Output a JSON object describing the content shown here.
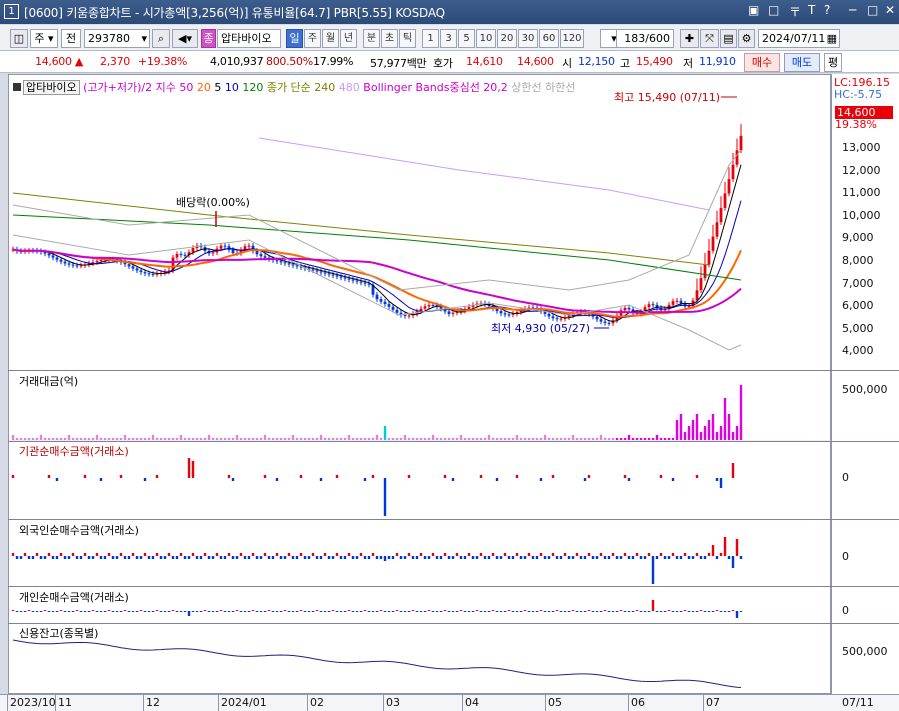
{
  "window": {
    "number": "1",
    "title": "[0600] 키움종합차트 - 시가총액[3,256(억)] 유통비율[64.7] PBR[5.55] KOSDAQ"
  },
  "toolbar": {
    "market": "주",
    "kind": "전",
    "code": "293780",
    "stock_badge": "종",
    "stock_name": "압타바이오",
    "periods": [
      "일",
      "주",
      "월",
      "년",
      "분",
      "초",
      "틱"
    ],
    "selected_period": "일",
    "intervals": [
      "1",
      "3",
      "5",
      "10",
      "20",
      "30",
      "60",
      "120"
    ],
    "count": "183",
    "count_total": "/600",
    "date": "2024/07/11"
  },
  "quote": {
    "price": "14,600",
    "arrow": "▲",
    "change": "2,370",
    "change_pct": "+19.38%",
    "volume": "4,010,937",
    "vol_ratio": "800.50%",
    "turnover": "17.99%",
    "amount": "57,977백만",
    "ask_label": "호가",
    "ask": "14,610",
    "bid": "14,600",
    "open_label": "시",
    "open": "12,150",
    "high_label": "고",
    "high": "15,490",
    "low_label": "저",
    "low": "11,910",
    "buy": "매수",
    "sell": "매도",
    "eval": "평"
  },
  "price_panel": {
    "name": "압타바이오",
    "legend": [
      {
        "text": "(고가+저가)/2 지수 50",
        "color": "#cc00cc"
      },
      {
        "text": "20",
        "color": "#ff6600"
      },
      {
        "text": "5",
        "color": "#000000"
      },
      {
        "text": "10",
        "color": "#0000cc"
      },
      {
        "text": "120",
        "color": "#008000"
      },
      {
        "text": "종가 단순 240",
        "color": "#808000"
      },
      {
        "text": "480",
        "color": "#cc99ff"
      },
      {
        "text": "Bollinger Bands중심선 20,2",
        "color": "#cc00cc"
      },
      {
        "text": "상한선",
        "color": "#aaaaaa"
      },
      {
        "text": "하한선",
        "color": "#aaaaaa"
      }
    ],
    "annotations": {
      "high": "최고 15,490 (07/11)",
      "low": "최저 4,930 (05/27)",
      "dividend": "배당락(0.00%)"
    },
    "axis": [
      "13,000",
      "12,000",
      "11,000",
      "10,000",
      "9,000",
      "8,000",
      "7,000",
      "6,000",
      "5,000",
      "4,000"
    ],
    "lc": "LC:196.15",
    "hc": "HC:-5.75",
    "current": "14,600",
    "current_pct": "19.38%"
  },
  "panels": {
    "amount": {
      "name": "거래대금(억)",
      "axis": "500,000"
    },
    "inst": {
      "name": "기관순매수금액(거래소)",
      "axis": "0"
    },
    "foreign": {
      "name": "외국인순매수금액(거래소)",
      "axis": "0"
    },
    "retail": {
      "name": "개인순매수금액(거래소)",
      "axis": "0"
    },
    "credit": {
      "name": "신용잔고(종목별)",
      "axis": "500,000"
    }
  },
  "xaxis": {
    "labels": [
      "2023/10",
      "11",
      "12",
      "2024/01",
      "02",
      "03",
      "04",
      "05",
      "06",
      "07"
    ],
    "right": "07/11"
  },
  "colors": {
    "up": "#e8000b",
    "down": "#0037da",
    "accent": "#3c6fd0"
  }
}
